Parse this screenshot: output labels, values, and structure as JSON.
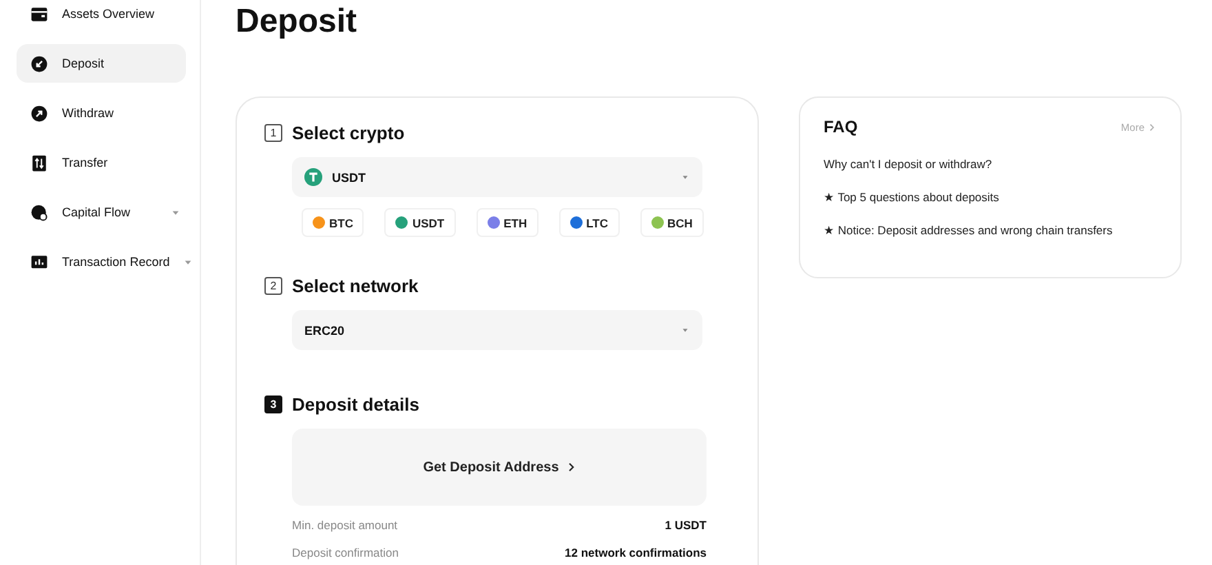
{
  "sidebar": {
    "items": [
      {
        "label": "Assets Overview",
        "selected": false,
        "has_submenu": false
      },
      {
        "label": "Deposit",
        "selected": true,
        "has_submenu": false
      },
      {
        "label": "Withdraw",
        "selected": false,
        "has_submenu": false
      },
      {
        "label": "Transfer",
        "selected": false,
        "has_submenu": false
      },
      {
        "label": "Capital Flow",
        "selected": false,
        "has_submenu": true
      },
      {
        "label": "Transaction Record",
        "selected": false,
        "has_submenu": true
      }
    ]
  },
  "page_title": "Deposit",
  "steps": [
    {
      "number": "1",
      "title": "Select crypto",
      "active": false,
      "kind": "crypto",
      "select": {
        "value": "USDT",
        "color": "#26a17b"
      },
      "coins": [
        {
          "label": "BTC",
          "color": "#f7931a"
        },
        {
          "label": "USDT",
          "color": "#26a17b"
        },
        {
          "label": "ETH",
          "color": "#7b7fe8"
        },
        {
          "label": "LTC",
          "color": "#1e6fd9"
        },
        {
          "label": "BCH",
          "color": "#8dc351"
        }
      ]
    },
    {
      "number": "2",
      "title": "Select network",
      "active": false,
      "kind": "network",
      "select": {
        "value": "ERC20"
      }
    },
    {
      "number": "3",
      "title": "Deposit details",
      "active": true,
      "kind": "details",
      "address_button": "Get Deposit Address",
      "rows": [
        {
          "label": "Min. deposit amount",
          "value": "1 USDT"
        },
        {
          "label": "Deposit confirmation",
          "value": "12 network confirmations"
        }
      ]
    }
  ],
  "faq": {
    "title": "FAQ",
    "more": "More",
    "items": [
      "Why can't I deposit or withdraw?",
      "★ Top 5 questions about deposits",
      "★ Notice: Deposit addresses and wrong chain transfers"
    ]
  }
}
